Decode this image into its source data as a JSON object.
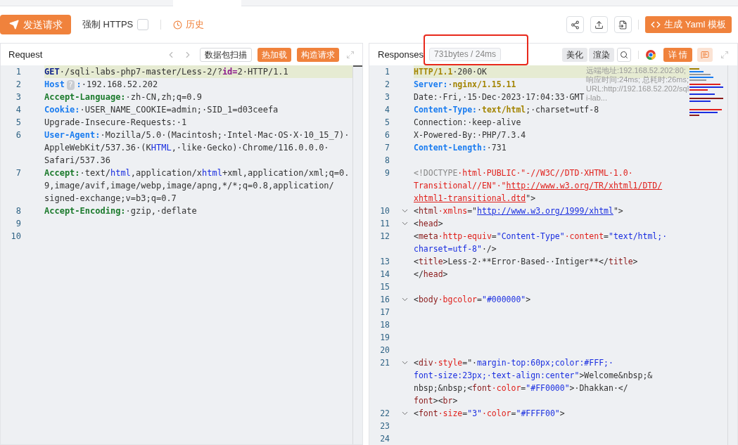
{
  "toolbar": {
    "send_button": "发送请求",
    "force_https": {
      "label": "强制 HTTPS",
      "checked": false
    },
    "history": "历史",
    "yaml_button": "生成 Yaml 模板"
  },
  "request": {
    "title": "Request",
    "buttons": [
      {
        "label": "数据包扫描",
        "kind": "outline"
      },
      {
        "label": "热加载",
        "kind": "primary"
      },
      {
        "label": "构造请求",
        "kind": "primary"
      }
    ],
    "lines": [
      {
        "number": "1",
        "highlighted": true,
        "fold": false,
        "rows": [
          {
            "tokens": [
              {
                "text": "GET",
                "kind": "method"
              },
              {
                "text": "·/sqli-labs-php7-master/Less-2/?",
                "kind": "plain"
              },
              {
                "text": "id=",
                "kind": "param"
              },
              {
                "text": "2·HTTP/1.1",
                "kind": "plain"
              }
            ]
          }
        ]
      },
      {
        "number": "2",
        "highlighted": false,
        "fold": false,
        "rows": [
          {
            "tokens": [
              {
                "text": "Host",
                "kind": "key"
              },
              {
                "text": "?",
                "kind": "badge"
              },
              {
                "text": ":",
                "kind": "key"
              },
              {
                "text": "·192.168.52.202",
                "kind": "plain"
              }
            ]
          }
        ]
      },
      {
        "number": "3",
        "highlighted": false,
        "fold": false,
        "rows": [
          {
            "tokens": [
              {
                "text": "Accept-Language:",
                "kind": "key2"
              },
              {
                "text": "·zh-CN,zh;q=0.9",
                "kind": "plain"
              }
            ]
          }
        ]
      },
      {
        "number": "4",
        "highlighted": false,
        "fold": false,
        "rows": [
          {
            "tokens": [
              {
                "text": "Cookie:",
                "kind": "key"
              },
              {
                "text": "·USER_NAME_COOKIE=admin;·SID_1=d03ceefa",
                "kind": "plain"
              }
            ]
          }
        ]
      },
      {
        "number": "5",
        "highlighted": false,
        "fold": false,
        "rows": [
          {
            "tokens": [
              {
                "text": "Upgrade-Insecure-Requests:·1",
                "kind": "plain"
              }
            ]
          }
        ]
      },
      {
        "number": "6",
        "highlighted": false,
        "fold": false,
        "rows": [
          {
            "tokens": [
              {
                "text": "User-Agent:",
                "kind": "key"
              },
              {
                "text": "·Mozilla/5.0·(Macintosh;·Intel·Mac·OS·X·10_15_7)·",
                "kind": "plain"
              }
            ]
          },
          {
            "tokens": [
              {
                "text": "AppleWebKit/537.36·(K",
                "kind": "plain"
              },
              {
                "text": "HTML",
                "kind": "keyword"
              },
              {
                "text": ",·like·Gecko)·Chrome/116.0.0.0·",
                "kind": "plain"
              }
            ]
          },
          {
            "tokens": [
              {
                "text": "Safari/537.36",
                "kind": "plain"
              }
            ]
          }
        ]
      },
      {
        "number": "7",
        "highlighted": false,
        "fold": false,
        "rows": [
          {
            "tokens": [
              {
                "text": "Accept:",
                "kind": "key2"
              },
              {
                "text": "·text/",
                "kind": "plain"
              },
              {
                "text": "html",
                "kind": "keyword"
              },
              {
                "text": ",application/x",
                "kind": "plain"
              },
              {
                "text": "html",
                "kind": "keyword"
              },
              {
                "text": "+xml,application/xml;q=0.",
                "kind": "plain"
              }
            ]
          },
          {
            "tokens": [
              {
                "text": "9,image/avif,image/webp,image/apng,*/*;q=0.8,application/",
                "kind": "plain"
              }
            ]
          },
          {
            "tokens": [
              {
                "text": "signed-exchange;v=b3;q=0.7",
                "kind": "plain"
              }
            ]
          }
        ]
      },
      {
        "number": "8",
        "highlighted": false,
        "fold": false,
        "rows": [
          {
            "tokens": [
              {
                "text": "Accept-Encoding:",
                "kind": "key2"
              },
              {
                "text": "·gzip,·deflate",
                "kind": "plain"
              }
            ]
          }
        ]
      },
      {
        "number": "9",
        "highlighted": false,
        "fold": false,
        "rows": [
          {
            "tokens": []
          }
        ]
      },
      {
        "number": "10",
        "highlighted": false,
        "fold": false,
        "rows": [
          {
            "tokens": []
          }
        ]
      }
    ]
  },
  "response": {
    "title": "Responses",
    "stats": "731bytes / 24ms",
    "buttons": [
      {
        "label": "美化",
        "kind": "gray"
      },
      {
        "label": "渲染",
        "kind": "gray"
      }
    ],
    "detail_button": "详 情",
    "info": [
      "远端地址:192.168.52.202:80;",
      "响应时间:24ms; 总耗时:26ms;",
      "URL:http://192.168.52.202/sql",
      "i-lab..."
    ],
    "lines": [
      {
        "number": "1",
        "highlighted": true,
        "fold": false,
        "rows": [
          {
            "tokens": [
              {
                "text": "HTTP/1.1",
                "kind": "value"
              },
              {
                "text": "·200·OK",
                "kind": "plain"
              }
            ]
          }
        ]
      },
      {
        "number": "2",
        "highlighted": false,
        "fold": false,
        "rows": [
          {
            "tokens": [
              {
                "text": "Server:",
                "kind": "key"
              },
              {
                "text": "·",
                "kind": "plain"
              },
              {
                "text": "nginx/1.15.11",
                "kind": "value"
              }
            ]
          }
        ]
      },
      {
        "number": "3",
        "highlighted": false,
        "fold": false,
        "rows": [
          {
            "tokens": [
              {
                "text": "Date:·Fri,·15·Dec·2023·17:04:33·GMT",
                "kind": "plain"
              }
            ]
          }
        ]
      },
      {
        "number": "4",
        "highlighted": false,
        "fold": false,
        "rows": [
          {
            "tokens": [
              {
                "text": "Content-Type:",
                "kind": "key"
              },
              {
                "text": "·",
                "kind": "plain"
              },
              {
                "text": "text/html",
                "kind": "value"
              },
              {
                "text": ";·charset=utf-8",
                "kind": "plain"
              }
            ]
          }
        ]
      },
      {
        "number": "5",
        "highlighted": false,
        "fold": false,
        "rows": [
          {
            "tokens": [
              {
                "text": "Connection:·keep-alive",
                "kind": "plain"
              }
            ]
          }
        ]
      },
      {
        "number": "6",
        "highlighted": false,
        "fold": false,
        "rows": [
          {
            "tokens": [
              {
                "text": "X-Powered-By:·PHP/7.3.4",
                "kind": "plain"
              }
            ]
          }
        ]
      },
      {
        "number": "7",
        "highlighted": false,
        "fold": false,
        "rows": [
          {
            "tokens": [
              {
                "text": "Content-Length:",
                "kind": "key"
              },
              {
                "text": "·731",
                "kind": "plain"
              }
            ]
          }
        ]
      },
      {
        "number": "8",
        "highlighted": false,
        "fold": false,
        "rows": [
          {
            "tokens": []
          }
        ]
      },
      {
        "number": "9",
        "highlighted": false,
        "fold": false,
        "rows": [
          {
            "tokens": [
              {
                "text": "<!DOCTYPE",
                "kind": "muted"
              },
              {
                "text": "·html·PUBLIC·\"-//W3C//DTD·XHTML·1.0·",
                "kind": "attr"
              }
            ]
          },
          {
            "tokens": [
              {
                "text": "Transitional//EN\"·\"",
                "kind": "attr"
              },
              {
                "text": "http://www.w3.org/TR/xhtml1/DTD/",
                "kind": "link-red"
              }
            ]
          },
          {
            "tokens": [
              {
                "text": "xhtml1-transitional.dtd",
                "kind": "link-red"
              },
              {
                "text": "\">",
                "kind": "plain"
              }
            ]
          }
        ]
      },
      {
        "number": "10",
        "highlighted": false,
        "fold": true,
        "rows": [
          {
            "tokens": [
              {
                "text": "<",
                "kind": "plain"
              },
              {
                "text": "html",
                "kind": "tag"
              },
              {
                "text": "·xmlns",
                "kind": "attr"
              },
              {
                "text": "=\"",
                "kind": "plain"
              },
              {
                "text": "http://www.w3.org/1999/xhtml",
                "kind": "link"
              },
              {
                "text": "\">",
                "kind": "plain"
              }
            ]
          }
        ]
      },
      {
        "number": "11",
        "highlighted": false,
        "fold": true,
        "rows": [
          {
            "tokens": [
              {
                "text": "<",
                "kind": "plain"
              },
              {
                "text": "head",
                "kind": "tag"
              },
              {
                "text": ">",
                "kind": "plain"
              }
            ]
          }
        ]
      },
      {
        "number": "12",
        "highlighted": false,
        "fold": false,
        "rows": [
          {
            "tokens": [
              {
                "text": "<",
                "kind": "plain"
              },
              {
                "text": "meta",
                "kind": "tag"
              },
              {
                "text": "·http-equiv",
                "kind": "attr"
              },
              {
                "text": "=",
                "kind": "plain"
              },
              {
                "text": "\"Content-Type\"",
                "kind": "string"
              },
              {
                "text": "·content",
                "kind": "attr"
              },
              {
                "text": "=",
                "kind": "plain"
              },
              {
                "text": "\"text/html;·",
                "kind": "string"
              }
            ]
          },
          {
            "tokens": [
              {
                "text": "charset=utf-8\"",
                "kind": "string"
              },
              {
                "text": "·/>",
                "kind": "plain"
              }
            ]
          }
        ]
      },
      {
        "number": "13",
        "highlighted": false,
        "fold": false,
        "rows": [
          {
            "tokens": [
              {
                "text": "<",
                "kind": "plain"
              },
              {
                "text": "title",
                "kind": "tag"
              },
              {
                "text": ">Less-2·**Error·Based-·Intiger**</",
                "kind": "plain"
              },
              {
                "text": "title",
                "kind": "tag"
              },
              {
                "text": ">",
                "kind": "plain"
              }
            ]
          }
        ]
      },
      {
        "number": "14",
        "highlighted": false,
        "fold": false,
        "rows": [
          {
            "tokens": [
              {
                "text": "</",
                "kind": "plain"
              },
              {
                "text": "head",
                "kind": "tag"
              },
              {
                "text": ">",
                "kind": "plain"
              }
            ]
          }
        ]
      },
      {
        "number": "15",
        "highlighted": false,
        "fold": false,
        "rows": [
          {
            "tokens": []
          }
        ]
      },
      {
        "number": "16",
        "highlighted": false,
        "fold": true,
        "rows": [
          {
            "tokens": [
              {
                "text": "<",
                "kind": "plain"
              },
              {
                "text": "body",
                "kind": "tag"
              },
              {
                "text": "·bgcolor",
                "kind": "attr"
              },
              {
                "text": "=",
                "kind": "plain"
              },
              {
                "text": "\"#000000\"",
                "kind": "string"
              },
              {
                "text": ">",
                "kind": "plain"
              }
            ]
          }
        ]
      },
      {
        "number": "17",
        "highlighted": false,
        "fold": false,
        "rows": [
          {
            "tokens": []
          }
        ]
      },
      {
        "number": "18",
        "highlighted": false,
        "fold": false,
        "rows": [
          {
            "tokens": []
          }
        ]
      },
      {
        "number": "19",
        "highlighted": false,
        "fold": false,
        "rows": [
          {
            "tokens": []
          }
        ]
      },
      {
        "number": "20",
        "highlighted": false,
        "fold": false,
        "rows": [
          {
            "tokens": []
          }
        ]
      },
      {
        "number": "21",
        "highlighted": false,
        "fold": true,
        "rows": [
          {
            "tokens": [
              {
                "text": "<",
                "kind": "plain"
              },
              {
                "text": "div",
                "kind": "tag"
              },
              {
                "text": "·style",
                "kind": "attr"
              },
              {
                "text": "=\"·",
                "kind": "plain"
              },
              {
                "text": "margin-top:60px;color:#FFF;·",
                "kind": "string"
              }
            ]
          },
          {
            "tokens": [
              {
                "text": "font-size:23px;·text-align:center\"",
                "kind": "string"
              },
              {
                "text": ">Welcome&nbsp;&",
                "kind": "plain"
              }
            ]
          },
          {
            "tokens": [
              {
                "text": "nbsp;&nbsp;<",
                "kind": "plain"
              },
              {
                "text": "font",
                "kind": "tag"
              },
              {
                "text": "·color",
                "kind": "attr"
              },
              {
                "text": "=",
                "kind": "plain"
              },
              {
                "text": "\"#FF0000\"",
                "kind": "string"
              },
              {
                "text": ">·Dhakkan·</",
                "kind": "plain"
              }
            ]
          },
          {
            "tokens": [
              {
                "text": "font",
                "kind": "tag"
              },
              {
                "text": "><",
                "kind": "plain"
              },
              {
                "text": "br",
                "kind": "tag"
              },
              {
                "text": ">",
                "kind": "plain"
              }
            ]
          }
        ]
      },
      {
        "number": "22",
        "highlighted": false,
        "fold": true,
        "rows": [
          {
            "tokens": [
              {
                "text": "<",
                "kind": "plain"
              },
              {
                "text": "font",
                "kind": "tag"
              },
              {
                "text": "·size",
                "kind": "attr"
              },
              {
                "text": "=",
                "kind": "plain"
              },
              {
                "text": "\"3\"",
                "kind": "string"
              },
              {
                "text": "·color",
                "kind": "attr"
              },
              {
                "text": "=",
                "kind": "plain"
              },
              {
                "text": "\"#FFFF00\"",
                "kind": "string"
              },
              {
                "text": ">",
                "kind": "plain"
              }
            ]
          }
        ]
      },
      {
        "number": "23",
        "highlighted": false,
        "fold": false,
        "rows": [
          {
            "tokens": []
          }
        ]
      },
      {
        "number": "24",
        "highlighted": false,
        "fold": false,
        "rows": [
          {
            "tokens": []
          }
        ]
      }
    ]
  }
}
